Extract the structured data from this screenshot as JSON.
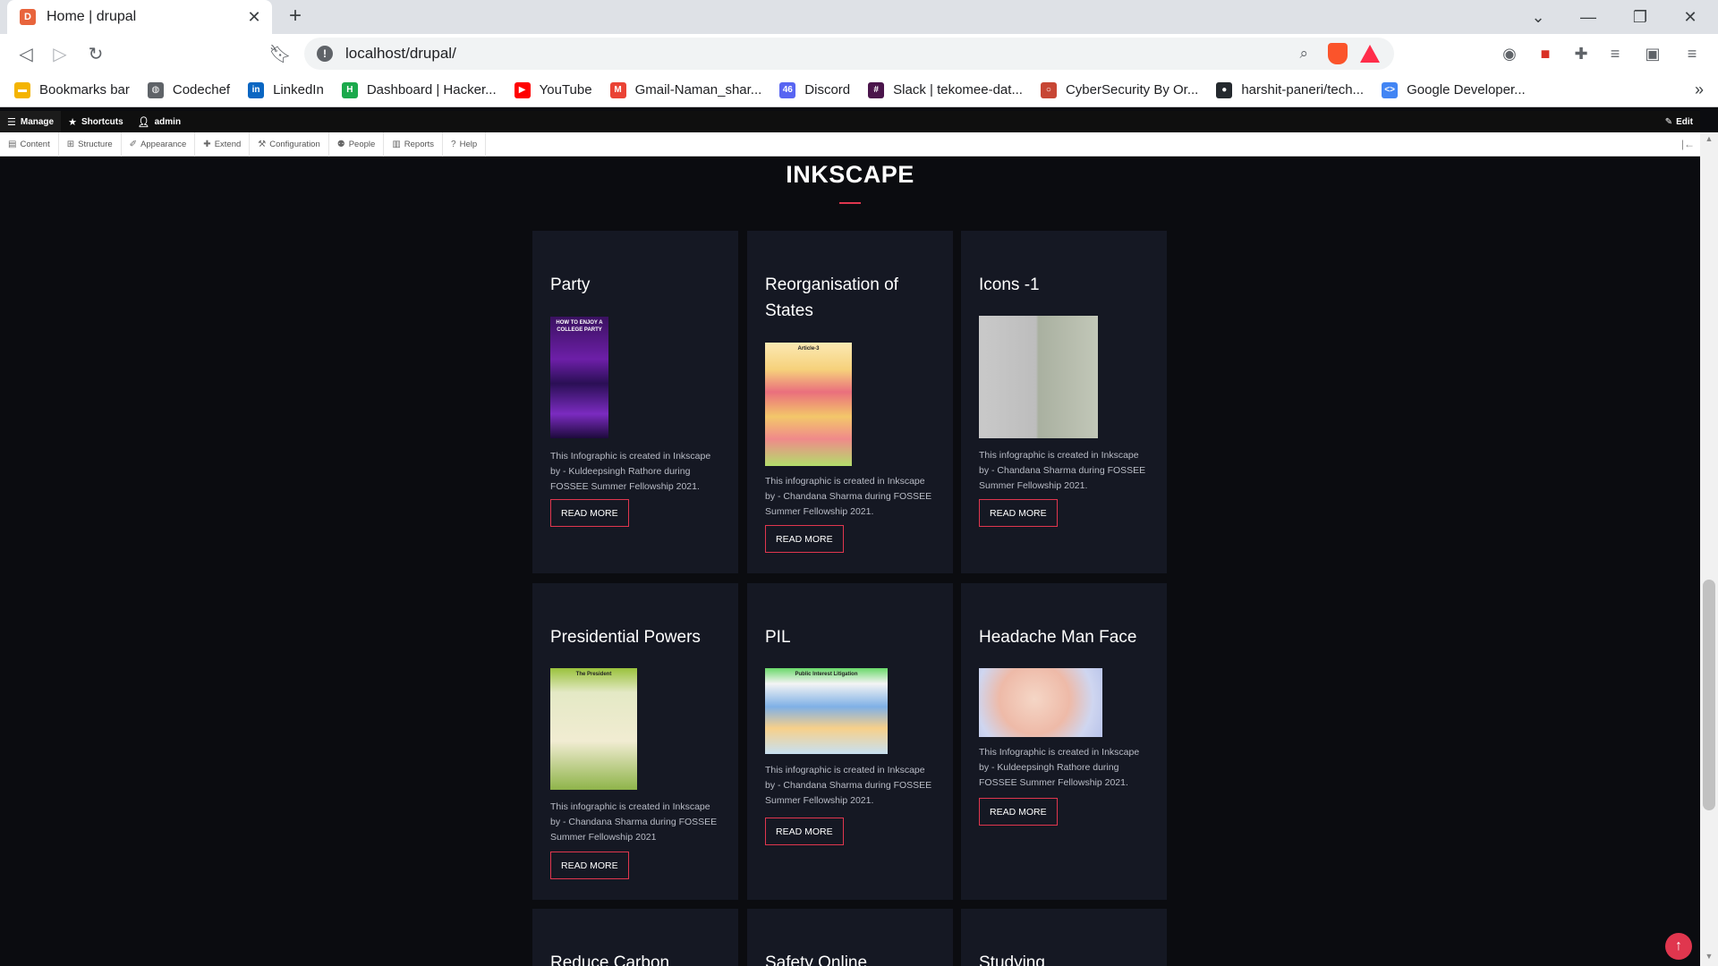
{
  "browser": {
    "tab_title": "Home | drupal",
    "favicon_letter": "D",
    "url": "localhost/drupal/",
    "bookmarks": [
      {
        "label": "Bookmarks bar",
        "icon": "folder-icon",
        "color": "#f4b400"
      },
      {
        "label": "Codechef",
        "icon": "globe-icon",
        "color": "#5f6368"
      },
      {
        "label": "LinkedIn",
        "icon": "linkedin-icon",
        "color": "#0a66c2"
      },
      {
        "label": "Dashboard | Hacker...",
        "icon": "hackerrank-icon",
        "color": "#1ba94c"
      },
      {
        "label": "YouTube",
        "icon": "youtube-icon",
        "color": "#ff0000"
      },
      {
        "label": "Gmail-Naman_shar...",
        "icon": "gmail-icon",
        "color": "#ea4335"
      },
      {
        "label": "Discord",
        "icon": "discord-icon",
        "color": "#5865f2"
      },
      {
        "label": "Slack | tekomee-dat...",
        "icon": "slack-icon",
        "color": "#4a154b"
      },
      {
        "label": "CyberSecurity By Or...",
        "icon": "oracle-icon",
        "color": "#c74634"
      },
      {
        "label": "harshit-paneri/tech...",
        "icon": "github-icon",
        "color": "#24292e"
      },
      {
        "label": "Google Developer...",
        "icon": "google-dev-icon",
        "color": "#4285f4"
      }
    ]
  },
  "admin_toolbar": {
    "items": [
      {
        "label": "Manage",
        "icon": "menu-icon"
      },
      {
        "label": "Shortcuts",
        "icon": "star-icon"
      },
      {
        "label": "admin",
        "icon": "user-icon"
      }
    ],
    "edit_label": "Edit",
    "tray": [
      {
        "label": "Content",
        "icon": "file-icon"
      },
      {
        "label": "Structure",
        "icon": "structure-icon"
      },
      {
        "label": "Appearance",
        "icon": "brush-icon"
      },
      {
        "label": "Extend",
        "icon": "puzzle-icon"
      },
      {
        "label": "Configuration",
        "icon": "wrench-icon"
      },
      {
        "label": "People",
        "icon": "people-icon"
      },
      {
        "label": "Reports",
        "icon": "bar-chart-icon"
      },
      {
        "label": "Help",
        "icon": "help-icon"
      }
    ]
  },
  "section": {
    "title": "INKSCAPE",
    "read_more_label": "READ MORE",
    "accent_color": "#e0364e",
    "cards": [
      {
        "title": "Party",
        "desc": "This Infographic is created in Inkscape by - Kuldeepsingh Rathore during FOSSEE Summer Fellowship 2021."
      },
      {
        "title": "Reorganisation of States",
        "desc": "This infographic is created in Inkscape by - Chandana Sharma during FOSSEE Summer Fellowship 2021."
      },
      {
        "title": "Icons -1",
        "desc": "This infographic is created in Inkscape by - Chandana Sharma during FOSSEE Summer Fellowship 2021."
      },
      {
        "title": "Presidential Powers",
        "desc": "This infographic is created in Inkscape by - Chandana Sharma during FOSSEE Summer Fellowship 2021"
      },
      {
        "title": "PIL",
        "desc": "This infographic is created in Inkscape by - Chandana Sharma during FOSSEE Summer Fellowship 2021."
      },
      {
        "title": "Headache Man Face",
        "desc": "This Infographic is created in Inkscape by - Kuldeepsingh Rathore during FOSSEE Summer Fellowship 2021."
      },
      {
        "title": "Reduce Carbon",
        "desc": ""
      },
      {
        "title": "Safety Online",
        "desc": ""
      },
      {
        "title": "Studying",
        "desc": ""
      }
    ],
    "thumbnails": [
      {
        "text": "HOW TO ENJOY A COLLEGE PARTY"
      },
      {
        "text": "Article-3"
      },
      {
        "text": ""
      },
      {
        "text": "The President"
      },
      {
        "text": "Public Interest Litigation"
      },
      {
        "text": ""
      }
    ]
  }
}
